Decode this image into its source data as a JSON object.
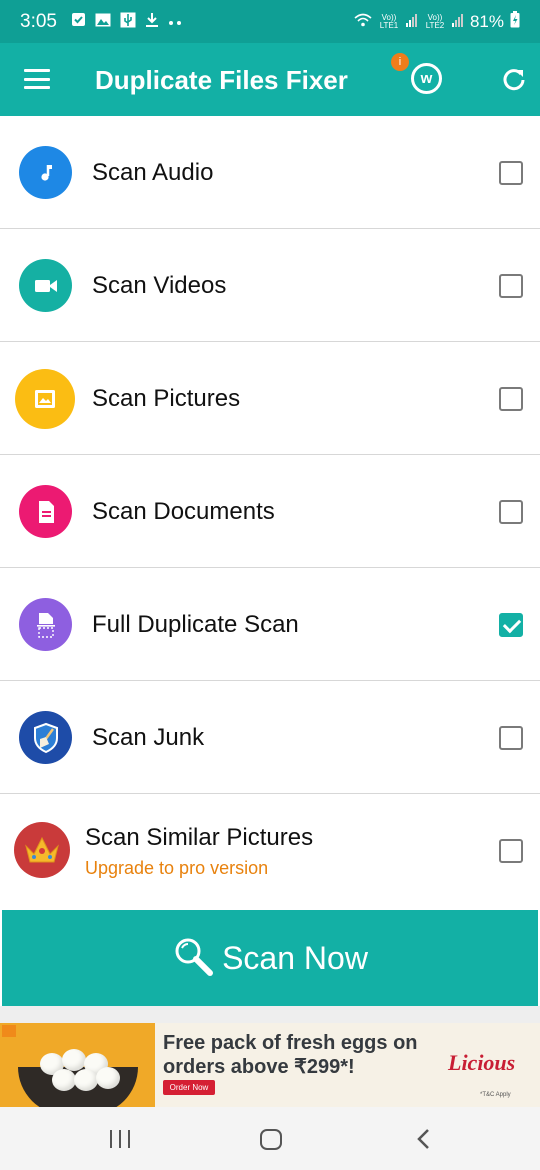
{
  "status_bar": {
    "time": "3:05",
    "lte1": "Vo)) LTE1",
    "lte2": "Vo)) LTE2",
    "battery": "81%"
  },
  "app_bar": {
    "title": "Duplicate Files Fixer",
    "badge": "i",
    "w_label": "w"
  },
  "scan_options": [
    {
      "label": "Scan Audio",
      "icon": "music-note-icon",
      "color": "#1e88e5",
      "checked": false
    },
    {
      "label": "Scan Videos",
      "icon": "video-camera-icon",
      "color": "#15b0a3",
      "checked": false
    },
    {
      "label": "Scan Pictures",
      "icon": "image-icon",
      "color": "#fbbd13",
      "checked": false
    },
    {
      "label": "Scan Documents",
      "icon": "document-icon",
      "color": "#ec1a72",
      "checked": false
    },
    {
      "label": "Full Duplicate Scan",
      "icon": "full-scan-icon",
      "color": "#8e5fe0",
      "checked": true
    },
    {
      "label": "Scan Junk",
      "icon": "broom-shield-icon",
      "color": "#1e4ca8",
      "checked": false
    },
    {
      "label": "Scan Similar Pictures",
      "sublabel": "Upgrade to pro version",
      "icon": "crown-icon",
      "color": "#c93a3a",
      "checked": false
    }
  ],
  "scan_button": {
    "label": "Scan Now",
    "icon": "magnifier-icon"
  },
  "ad": {
    "headline_line1": "Free pack of fresh eggs on",
    "headline_line2": "orders above ₹299*!",
    "cta": "Order Now",
    "brand": "Licious",
    "fine_print": "*T&C Apply"
  },
  "colors": {
    "status_bar": "#0f9f95",
    "app_bar": "#13b0a5",
    "accent": "#13b0a5",
    "upgrade_text": "#e8820e",
    "badge": "#ef7d1a"
  }
}
